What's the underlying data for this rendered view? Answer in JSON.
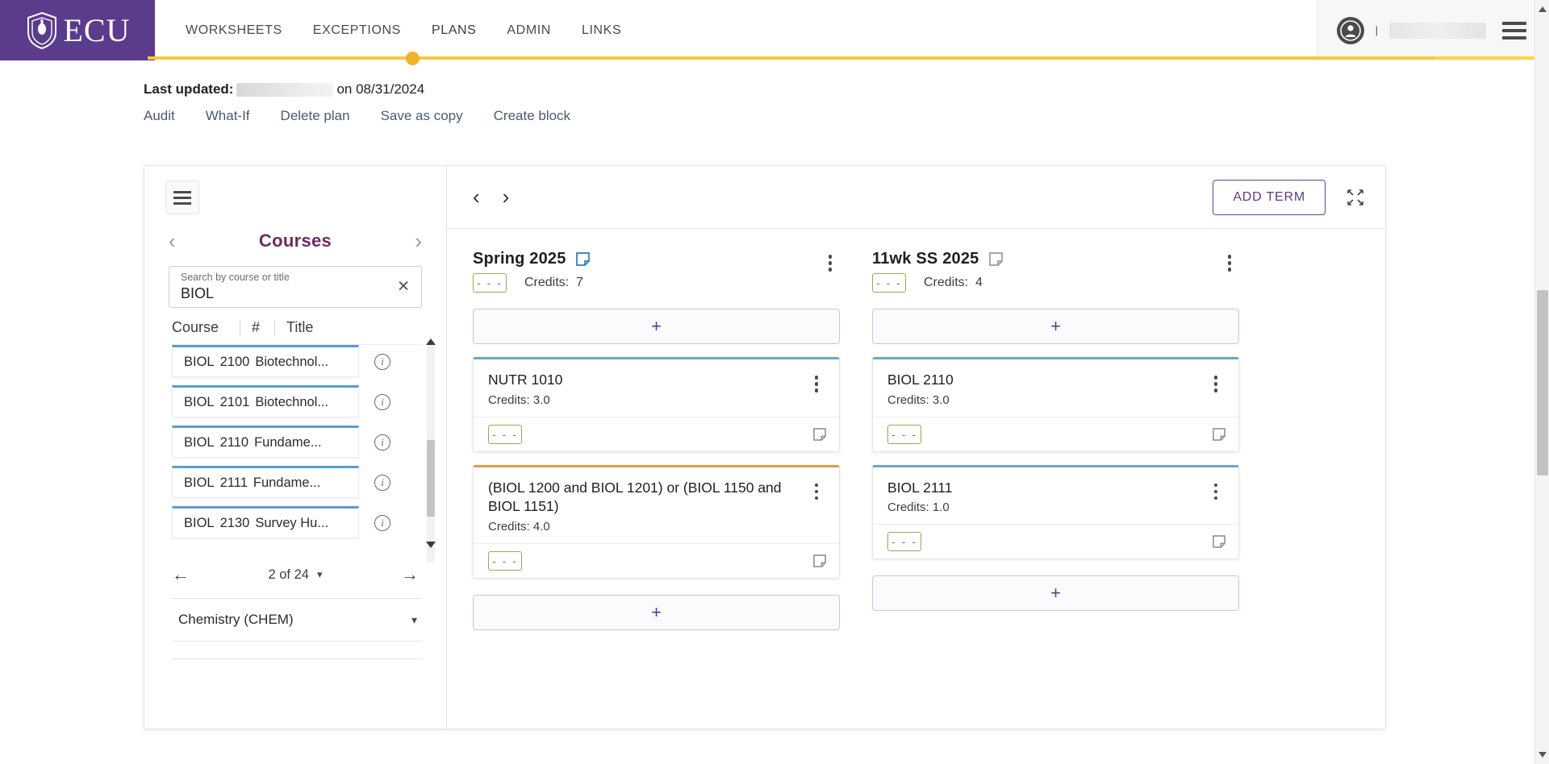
{
  "header": {
    "brand": "ECU",
    "nav": [
      {
        "label": "WORKSHEETS",
        "active": false
      },
      {
        "label": "EXCEPTIONS",
        "active": false
      },
      {
        "label": "PLANS",
        "active": true
      },
      {
        "label": "ADMIN",
        "active": false
      },
      {
        "label": "LINKS",
        "active": false
      }
    ],
    "user": {
      "name_redacted": true,
      "avatar_icon": "user-avatar-icon",
      "menu_icon": "hamburger-menu-icon"
    }
  },
  "meta": {
    "last_updated_label": "Last updated:",
    "last_updated_suffix": "on 08/31/2024",
    "links": [
      "Audit",
      "What-If",
      "Delete plan",
      "Save as copy",
      "Create block"
    ]
  },
  "sidebar": {
    "panel_toggle_icon": "panel-toggle-icon",
    "title": "Courses",
    "prev_icon": "chevron-left-icon",
    "next_icon": "chevron-right-icon",
    "search": {
      "label": "Search by course or title",
      "value": "BIOL",
      "clear_icon": "clear-icon"
    },
    "columns": [
      "Course",
      "#",
      "Title"
    ],
    "courses": [
      {
        "subject": "BIOL",
        "number": "2100",
        "title": "Biotechnol..."
      },
      {
        "subject": "BIOL",
        "number": "2101",
        "title": "Biotechnol..."
      },
      {
        "subject": "BIOL",
        "number": "2110",
        "title": "Fundame..."
      },
      {
        "subject": "BIOL",
        "number": "2111",
        "title": "Fundame..."
      },
      {
        "subject": "BIOL",
        "number": "2130",
        "title": "Survey Hu..."
      }
    ],
    "pagination": {
      "prev_icon": "arrow-left-icon",
      "label": "2 of 24",
      "caret_icon": "chevron-down-icon",
      "next_icon": "arrow-right-icon"
    },
    "subjects": [
      {
        "label": "Chemistry (CHEM)",
        "caret_icon": "chevron-down-icon"
      }
    ]
  },
  "plan": {
    "toolbar": {
      "prev_icon": "chevron-left-icon",
      "next_icon": "chevron-right-icon",
      "add_term_label": "ADD TERM",
      "expand_icon": "expand-collapse-icon"
    },
    "terms": [
      {
        "title": "Spring 2025",
        "note_icon": "term-note-icon",
        "note_active": true,
        "menu_icon": "kebab-menu-icon",
        "badge": "- - -",
        "credits_label": "Credits:",
        "credits_value": "7",
        "add_top_icon": "add-course-icon",
        "add_bottom_icon": "add-course-icon",
        "has_bottom_add": true,
        "courses": [
          {
            "title": "NUTR 1010",
            "credits_label": "Credits:",
            "credits_value": "3.0",
            "border": "blue",
            "badge": "- - -",
            "note_icon": "card-note-icon",
            "menu_icon": "kebab-menu-icon"
          },
          {
            "title": "(BIOL 1200 and BIOL 1201) or (BIOL 1150 and BIOL 1151)",
            "credits_label": "Credits:",
            "credits_value": "4.0",
            "border": "orange",
            "badge": "- - -",
            "note_icon": "card-note-icon",
            "menu_icon": "kebab-menu-icon"
          }
        ]
      },
      {
        "title": "11wk SS 2025",
        "note_icon": "term-note-icon",
        "note_active": false,
        "menu_icon": "kebab-menu-icon",
        "badge": "- - -",
        "credits_label": "Credits:",
        "credits_value": "4",
        "add_top_icon": "add-course-icon",
        "add_bottom_icon": "add-course-icon",
        "has_bottom_add": true,
        "courses": [
          {
            "title": "BIOL 2110",
            "credits_label": "Credits:",
            "credits_value": "3.0",
            "border": "blue",
            "badge": "- - -",
            "note_icon": "card-note-icon",
            "menu_icon": "kebab-menu-icon"
          },
          {
            "title": "BIOL 2111",
            "credits_label": "Credits:",
            "credits_value": "1.0",
            "border": "blue",
            "badge": "- - -",
            "note_icon": "card-note-icon",
            "menu_icon": "kebab-menu-icon"
          }
        ]
      }
    ]
  },
  "colors": {
    "brand_purple": "#5b3b8c",
    "gold": "#f4c842",
    "title_purple": "#6a2c5e",
    "card_blue": "#6da4ce",
    "card_orange": "#e09b4c",
    "badge_border": "#b59a53"
  }
}
